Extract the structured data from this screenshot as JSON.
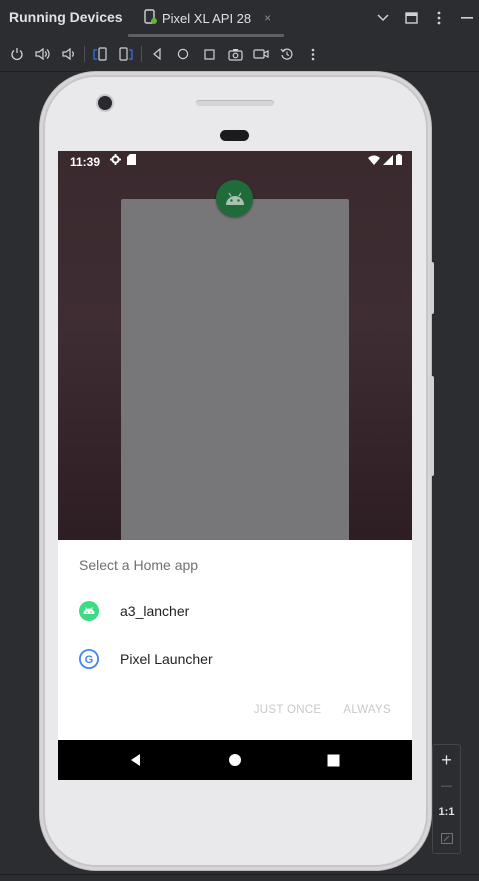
{
  "panel": {
    "title": "Running Devices",
    "device_tab": "Pixel XL API 28",
    "close_glyph": "×"
  },
  "toolbar": {
    "icons": [
      "power-icon",
      "volume-up-icon",
      "volume-down-icon",
      "rotate-left-icon",
      "rotate-right-icon",
      "back-icon",
      "home-icon",
      "overview-icon",
      "screenshot-icon",
      "screen-record-icon",
      "reset-icon",
      "more-icon"
    ]
  },
  "phone": {
    "status": {
      "time": "11:39"
    },
    "dialog": {
      "title": "Select a Home app",
      "options": [
        {
          "label": "a3_lancher",
          "icon": "android-app-icon",
          "icon_color": "#3ddc84"
        },
        {
          "label": "Pixel Launcher",
          "icon": "google-icon",
          "icon_color": "#4285f4"
        }
      ],
      "just_once": "JUST ONCE",
      "always": "ALWAYS"
    }
  },
  "zoom": {
    "plus": "+",
    "minus": "—",
    "actual": "1:1"
  },
  "colors": {
    "accent": "#3574f0",
    "wallpaper": "#3a2a2e",
    "card": "#777779",
    "nav": "#000000"
  }
}
